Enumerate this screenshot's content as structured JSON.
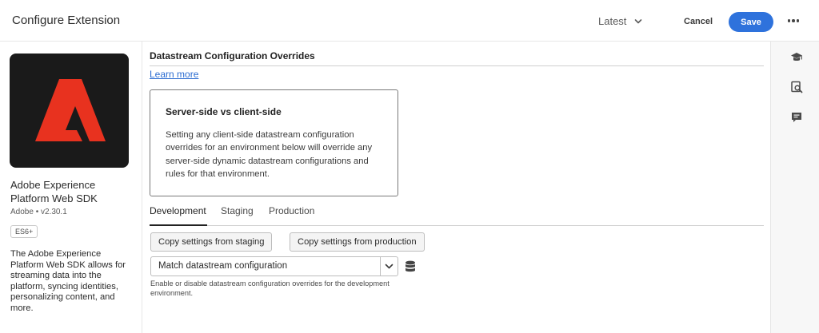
{
  "header": {
    "title": "Configure Extension",
    "version_label": "Latest",
    "cancel_label": "Cancel",
    "save_label": "Save"
  },
  "extension": {
    "name": "Adobe Experience Platform Web SDK",
    "meta": "Adobe • v2.30.1",
    "badge": "ES6+",
    "description": "The Adobe Experience Platform Web SDK allows for streaming data into the platform, syncing identities, personalizing content, and more.",
    "logo_icon": "adobe-logo",
    "logo_color": "#e8321f",
    "logo_bg": "#1a1a1a"
  },
  "main": {
    "section_title": "Datastream Configuration Overrides",
    "learn_more": "Learn more",
    "info_card": {
      "title": "Server-side vs client-side",
      "body": "Setting any client-side datastream configuration overrides for an environment below will override any server-side dynamic datastream configurations and rules for that environment."
    },
    "tabs": [
      {
        "label": "Development",
        "active": true
      },
      {
        "label": "Staging",
        "active": false
      },
      {
        "label": "Production",
        "active": false
      }
    ],
    "copy_staging_label": "Copy settings from staging",
    "copy_production_label": "Copy settings from production",
    "select_value": "Match datastream configuration",
    "help_text": "Enable or disable datastream configuration overrides for the development environment."
  },
  "rail": {
    "icons": [
      "graduation-cap-icon",
      "search-document-icon",
      "comment-icon"
    ]
  },
  "colors": {
    "accent": "#2e72dc",
    "link": "#2b6cd1"
  }
}
